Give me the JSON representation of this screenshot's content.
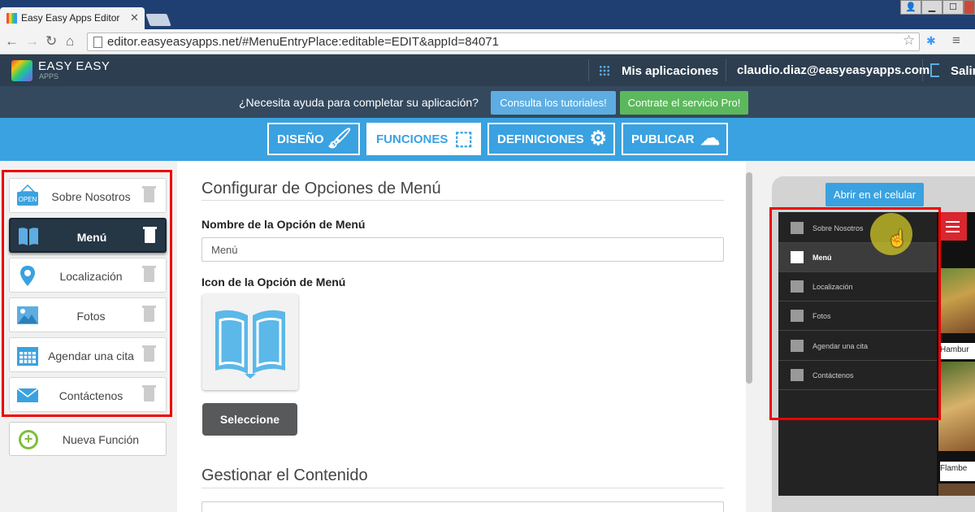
{
  "browser": {
    "tab_title": "Easy Easy Apps Editor",
    "url_text": "editor.easyeasyapps.net/#MenuEntryPlace:editable=EDIT&appId=84071"
  },
  "header": {
    "logo_line1": "EASY EASY",
    "logo_line2": "APPS",
    "my_apps": "Mis aplicaciones",
    "user_email": "claudio.diaz@easyeasyapps.com",
    "logout": "Salir"
  },
  "helpbar": {
    "question": "¿Necesita ayuda para completar su aplicación?",
    "tutorials_button": "Consulta los tutoriales!",
    "pro_button": "Contrate el servicio Pro!"
  },
  "tabs": [
    {
      "label": "DISEÑO",
      "icon": "brush-icon"
    },
    {
      "label": "FUNCIONES",
      "icon": "tags-icon",
      "active": true
    },
    {
      "label": "DEFINICIONES",
      "icon": "gear-icon"
    },
    {
      "label": "PUBLICAR",
      "icon": "cloud-upload-icon"
    }
  ],
  "sidebar": {
    "items": [
      {
        "label": "Sobre Nosotros",
        "icon": "open-sign-icon"
      },
      {
        "label": "Menú",
        "icon": "book-icon",
        "active": true
      },
      {
        "label": "Localización",
        "icon": "map-pin-icon"
      },
      {
        "label": "Fotos",
        "icon": "image-icon"
      },
      {
        "label": "Agendar una cita",
        "icon": "calendar-icon"
      },
      {
        "label": "Contáctenos",
        "icon": "envelope-icon"
      }
    ],
    "new_function": "Nueva Función"
  },
  "main": {
    "section_title": "Configurar de Opciones de Menú",
    "name_label": "Nombre de la Opción de Menú",
    "name_value": "Menú",
    "icon_label": "Icon de la Opción de Menú",
    "select_button": "Seleccione",
    "content_title": "Gestionar el Contenido"
  },
  "phone": {
    "open_button": "Abrir en el celular",
    "menu_items": [
      {
        "label": "Sobre Nosotros",
        "icon": "open-sign-icon"
      },
      {
        "label": "Menú",
        "icon": "book-icon",
        "active": true
      },
      {
        "label": "Localización",
        "icon": "map-pin-icon"
      },
      {
        "label": "Fotos",
        "icon": "image-icon"
      },
      {
        "label": "Agendar una cita",
        "icon": "calendar-icon"
      },
      {
        "label": "Contáctenos",
        "icon": "envelope-icon"
      }
    ],
    "preview_labels": [
      "Hambur",
      "Flambe"
    ]
  },
  "colors": {
    "accent_blue": "#3aa2e0",
    "header_dark": "#2c3e50",
    "highlight_red": "#ee0000",
    "pro_green": "#5cb85c"
  }
}
